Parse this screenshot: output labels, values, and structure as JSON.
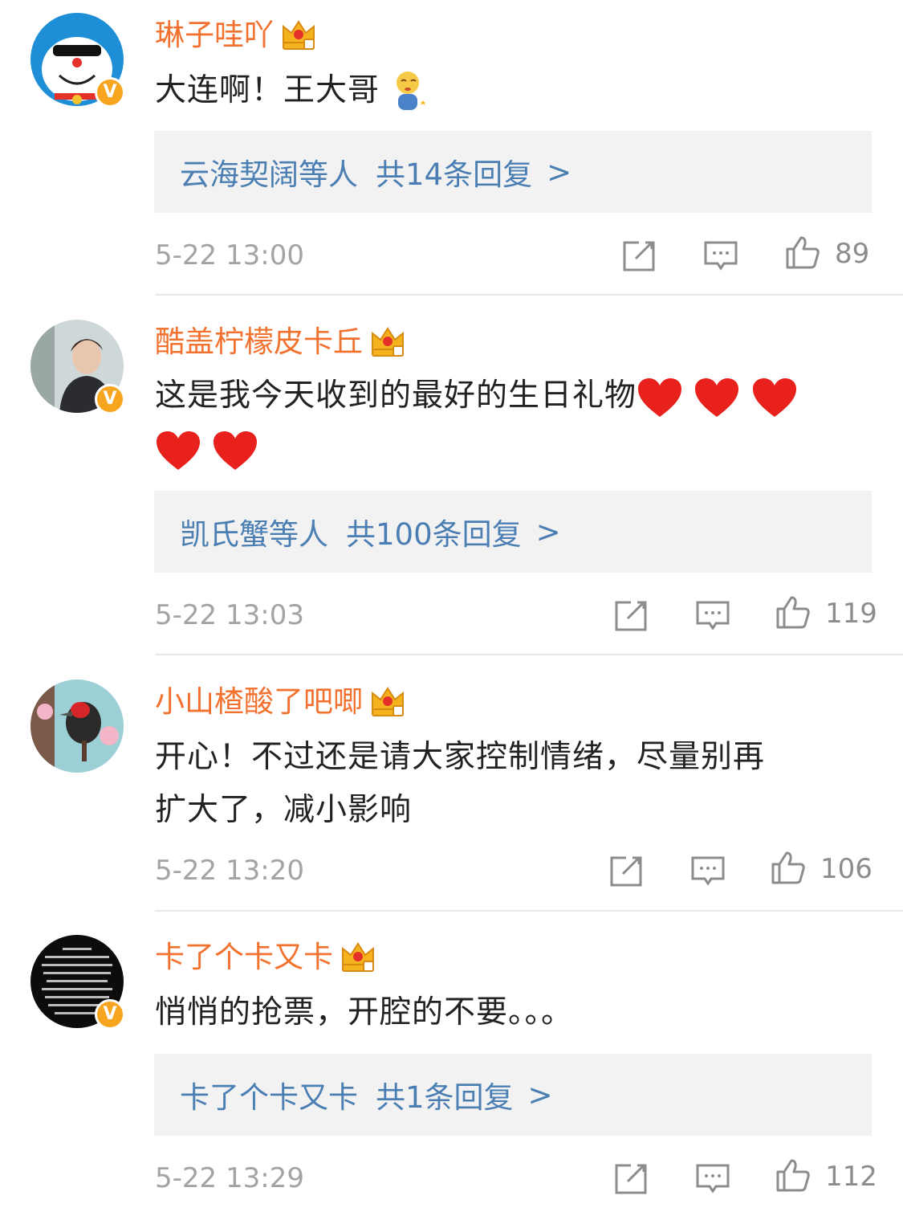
{
  "comments": [
    {
      "username": "琳子哇吖",
      "text": "大连啊！王大哥",
      "reply": {
        "users": "云海契阔",
        "suffix": "等人",
        "count": "共14条回复",
        "arrow": ">"
      },
      "time": "5-22 13:00",
      "likes": "89"
    },
    {
      "username": "酷盖柠檬皮卡丘",
      "text": "这是我今天收到的最好的生日礼物",
      "reply": {
        "users": "凯氏蟹",
        "suffix": "等人",
        "count": "共100条回复",
        "arrow": ">"
      },
      "time": "5-22 13:03",
      "likes": "119"
    },
    {
      "username": "小山楂酸了吧唧",
      "text_line1": "开心！不过还是请大家控制情绪，尽量别再",
      "text_line2": "扩大了，减小影响",
      "time": "5-22 13:20",
      "likes": "106"
    },
    {
      "username": "卡了个卡又卡",
      "text": "悄悄的抢票，开腔的不要。。。",
      "reply": {
        "users": "卡了个卡又卡",
        "suffix": "",
        "count": "共1条回复",
        "arrow": ">"
      },
      "time": "5-22 13:29",
      "likes": "112"
    }
  ],
  "badge": {
    "verified_letter": "V"
  },
  "colors": {
    "username": "#f3712f",
    "reply_link": "#4b7fb3",
    "reply_bg": "#f2f2f2",
    "timestamp": "#a3a3a3",
    "verified_badge": "#f7a51f"
  },
  "icons": [
    "share-icon",
    "comment-icon",
    "like-icon",
    "crown-badge-icon",
    "verified-badge-icon",
    "heart-emoji",
    "shy-emoji"
  ]
}
